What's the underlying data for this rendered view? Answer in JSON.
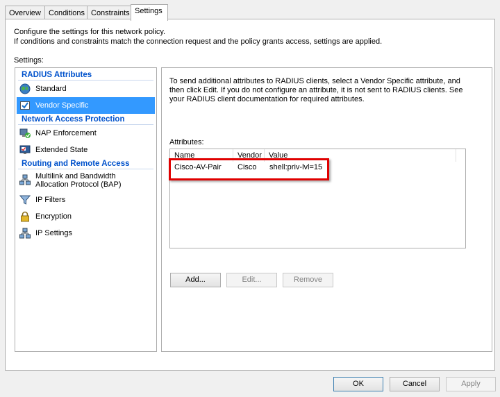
{
  "tabs": [
    "Overview",
    "Conditions",
    "Constraints",
    "Settings"
  ],
  "description": {
    "line1": "Configure the settings for this network policy.",
    "line2": "If conditions and constraints match the connection request and the policy grants access, settings are applied."
  },
  "settings_label": "Settings:",
  "sections": [
    {
      "header": "RADIUS Attributes",
      "items": [
        {
          "label": "Standard",
          "icon": "globe-icon"
        },
        {
          "label": "Vendor Specific",
          "icon": "checkbox-icon",
          "selected": true
        }
      ]
    },
    {
      "header": "Network Access Protection",
      "items": [
        {
          "label": "NAP Enforcement",
          "icon": "nap-icon"
        },
        {
          "label": "Extended State",
          "icon": "monitor-icon"
        }
      ]
    },
    {
      "header": "Routing and Remote Access",
      "items": [
        {
          "label": "Multilink and Bandwidth Allocation Protocol (BAP)",
          "icon": "network-icon"
        },
        {
          "label": "IP Filters",
          "icon": "filter-icon"
        },
        {
          "label": "Encryption",
          "icon": "lock-icon"
        },
        {
          "label": "IP Settings",
          "icon": "network-icon"
        }
      ]
    }
  ],
  "right": {
    "description": "To send additional attributes to RADIUS clients, select a Vendor Specific attribute, and then click Edit. If you do not configure an attribute, it is not sent to RADIUS clients. See your RADIUS client documentation for required attributes.",
    "attributes_label": "Attributes:",
    "columns": [
      "Name",
      "Vendor",
      "Value"
    ],
    "rows": [
      {
        "name": "Cisco-AV-Pair",
        "vendor": "Cisco",
        "value": "shell:priv-lvl=15"
      }
    ],
    "buttons": {
      "add": "Add...",
      "edit": "Edit...",
      "remove": "Remove"
    }
  },
  "footer": {
    "ok": "OK",
    "cancel": "Cancel",
    "apply": "Apply"
  },
  "colors": {
    "accent": "#3399ff",
    "section_header": "#0052cc",
    "highlight": "#e00000"
  }
}
